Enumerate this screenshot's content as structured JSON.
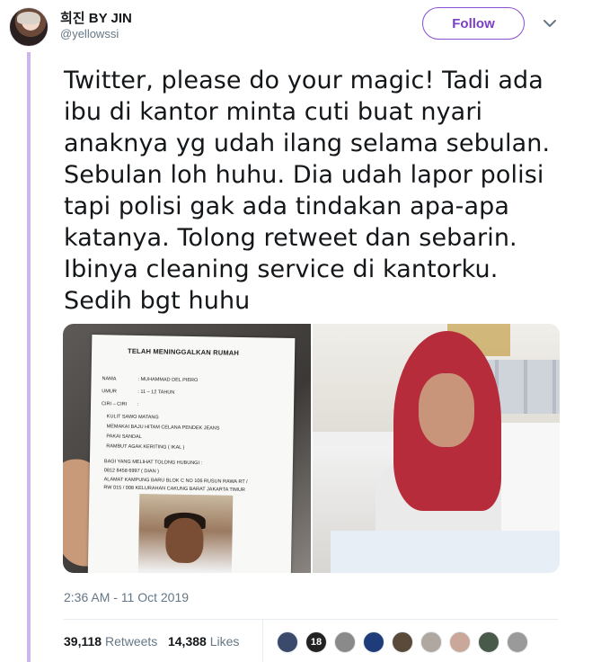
{
  "author": {
    "name": "희진 BY JIN",
    "handle": "@yellowssi"
  },
  "follow_label": "Follow",
  "tweet_text": "Twitter, please do your magic! Tadi ada ibu di kantor minta cuti buat nyari anaknya yg udah ilang selama sebulan. Sebulan loh huhu. Dia udah lapor polisi tapi polisi gak ada tindakan apa-apa katanya. Tolong retweet dan sebarin. Ibinya cleaning service di kantorku. Sedih bgt huhu",
  "poster": {
    "title": "TELAH MENINGGALKAN RUMAH",
    "fields": [
      {
        "label": "NAMA",
        "value": ": MUHAMMAD DEL PIERO"
      },
      {
        "label": "UMUR",
        "value": ": 11 – 12 TAHUN"
      },
      {
        "label": "CIRI – CIRI",
        "value": ":"
      }
    ],
    "bullets": [
      "KULIT SAWO MATANG",
      "MEMAKAI BAJU HITAM CELANA PENDEK JEANS",
      "PAKAI SANDAL",
      "RAMBUT AGAK KERITING ( IKAL )"
    ],
    "contact_lines": [
      "BAGI YANG MELIHAT TOLONG HUBUNGI :",
      "0812 8458 6997 ( DIAN )",
      "ALAMAT KAMPUNG BARU BLOK C NO 106 RUSUN RAWA RT /",
      "RW 015 / 008 KELURAHAN CAKUNG BARAT JAKARTA TIMUR"
    ]
  },
  "timestamp": "2:36 AM - 11 Oct 2019",
  "stats": {
    "retweets_count": "39,118",
    "retweets_label": "Retweets",
    "likes_count": "14,388",
    "likes_label": "Likes"
  },
  "liker_avatars": [
    {
      "color": "#3b4a6b",
      "text": ""
    },
    {
      "color": "#222222",
      "text": "18"
    },
    {
      "color": "#8a8a8a",
      "text": ""
    },
    {
      "color": "#1f3c7a",
      "text": ""
    },
    {
      "color": "#5a4a3a",
      "text": ""
    },
    {
      "color": "#b0a8a0",
      "text": ""
    },
    {
      "color": "#c9a89a",
      "text": ""
    },
    {
      "color": "#4a5a4a",
      "text": ""
    },
    {
      "color": "#9a9a9a",
      "text": ""
    }
  ],
  "colors": {
    "accent": "#7a3fc6",
    "thread_line": "#cbb7ec",
    "muted": "#657786"
  }
}
